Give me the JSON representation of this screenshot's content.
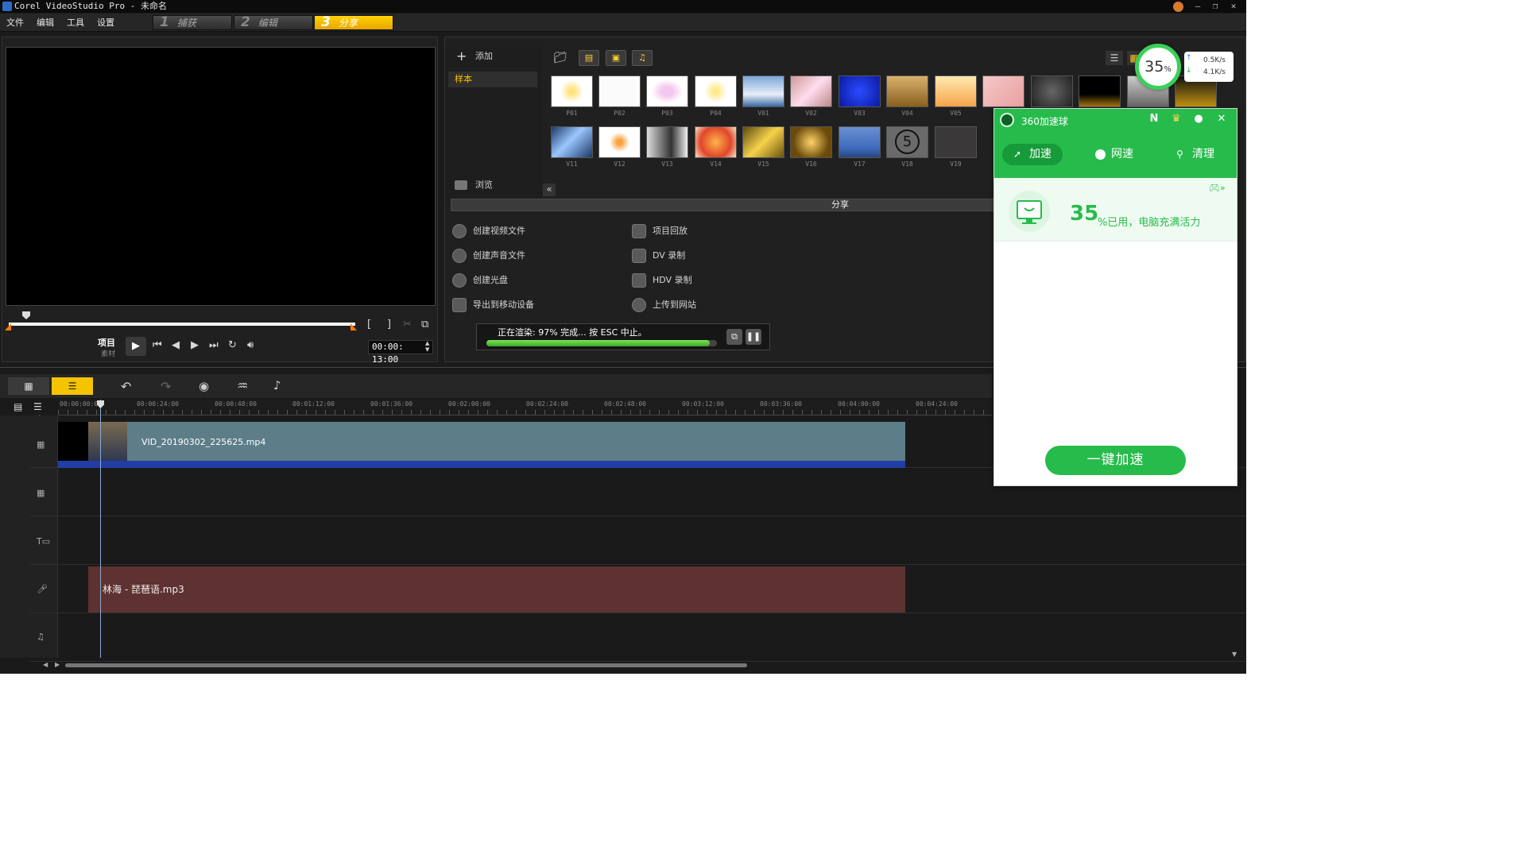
{
  "window": {
    "title": "Corel VideoStudio Pro - 未命名",
    "controls": [
      "minimize-icon",
      "restore-icon",
      "close-icon"
    ]
  },
  "menu": {
    "items": [
      "文件",
      "编辑",
      "工具",
      "设置"
    ],
    "steps": [
      {
        "num": "1",
        "label": "捕获"
      },
      {
        "num": "2",
        "label": "编辑"
      },
      {
        "num": "3",
        "label": "分享"
      }
    ],
    "active_step": "3"
  },
  "preview": {
    "mode_project": "项目",
    "mode_clip": "素材",
    "timecode": "00:00: 13:00",
    "mark_in": "[",
    "mark_out": "]"
  },
  "library": {
    "add_label": "添加",
    "sample_label": "样本",
    "browse_label": "浏览",
    "collapse": "«",
    "thumbs_row1": [
      "P01",
      "P02",
      "P03",
      "P04",
      "V01",
      "V02",
      "V03",
      "V04",
      "V05"
    ],
    "thumbs_row2": [
      "V11",
      "V12",
      "V13",
      "V14",
      "V15",
      "V16",
      "V17",
      "V18",
      "V19"
    ]
  },
  "share": {
    "header": "分享",
    "left_items": [
      "创建视频文件",
      "创建声音文件",
      "创建光盘",
      "导出到移动设备"
    ],
    "right_items": [
      "项目回放",
      "DV 录制",
      "HDV 录制",
      "上传到网站"
    ],
    "render_text": "正在渲染: 97% 完成... 按 ESC 中止。",
    "render_progress": 0.97
  },
  "timeline": {
    "ruler_ticks": [
      "00:00:00:00",
      "00:00:24:00",
      "00:00:48:00",
      "00:01:12:00",
      "00:01:36:00",
      "00:02:00:00",
      "00:02:24:00",
      "00:02:48:00",
      "00:03:12:00",
      "00:03:36:00",
      "00:04:00:00",
      "00:04:24:00"
    ],
    "video_clip": "VID_20190302_225625.mp4",
    "audio_clip": "林海 - 琵琶语.mp3",
    "zoom_label": "+/-"
  },
  "accelerator": {
    "ball_percent": "35",
    "ball_percent_sign": "%",
    "upload_speed": "0.5K/s",
    "download_speed": "4.1K/s",
    "title": "360加速球",
    "tabs": [
      "加速",
      "网速",
      "清理"
    ],
    "active_tab": "加速",
    "usage_number": "35",
    "usage_text": "%已用，电脑充满活力",
    "boost_button": "一键加速",
    "colors": {
      "brand": "#27bb4c"
    }
  }
}
